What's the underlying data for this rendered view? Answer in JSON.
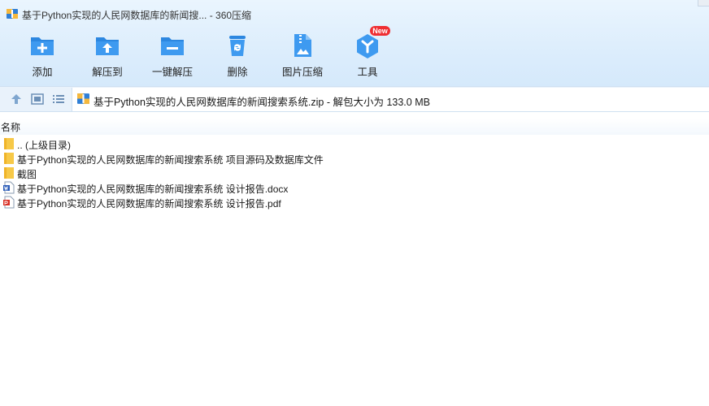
{
  "window": {
    "title": "基于Python实现的人民网数据库的新闻搜... - 360压缩",
    "logo_icon": "archive-logo-icon"
  },
  "toolbar": {
    "items": [
      {
        "label": "添加",
        "icon": "add-folder-icon"
      },
      {
        "label": "解压到",
        "icon": "extract-to-icon"
      },
      {
        "label": "一键解压",
        "icon": "one-click-extract-icon"
      },
      {
        "label": "删除",
        "icon": "recycle-bin-icon"
      },
      {
        "label": "图片压缩",
        "icon": "image-compress-icon"
      },
      {
        "label": "工具",
        "icon": "tools-icon"
      }
    ],
    "new_badge": "New"
  },
  "address": {
    "path": "基于Python实现的人民网数据库的新闻搜索系统.zip - 解包大小为 133.0 MB",
    "nav_icons": [
      "up-arrow-icon",
      "thumbnail-view-icon",
      "list-view-icon"
    ]
  },
  "list": {
    "column_name": "名称",
    "rows": [
      {
        "name": ".. (上级目录)",
        "icon": "folder-icon"
      },
      {
        "name": "基于Python实现的人民网数据库的新闻搜索系统 项目源码及数据库文件",
        "icon": "folder-icon"
      },
      {
        "name": "截图",
        "icon": "folder-icon"
      },
      {
        "name": "基于Python实现的人民网数据库的新闻搜索系统 设计报告.docx",
        "icon": "word-doc-icon"
      },
      {
        "name": "基于Python实现的人民网数据库的新闻搜索系统 设计报告.pdf",
        "icon": "pdf-icon"
      }
    ]
  },
  "colors": {
    "accent": "#1e88e5",
    "toolbar_bg": "#dcedfc",
    "folder": "#f7c948",
    "badge": "#ef2e32"
  }
}
